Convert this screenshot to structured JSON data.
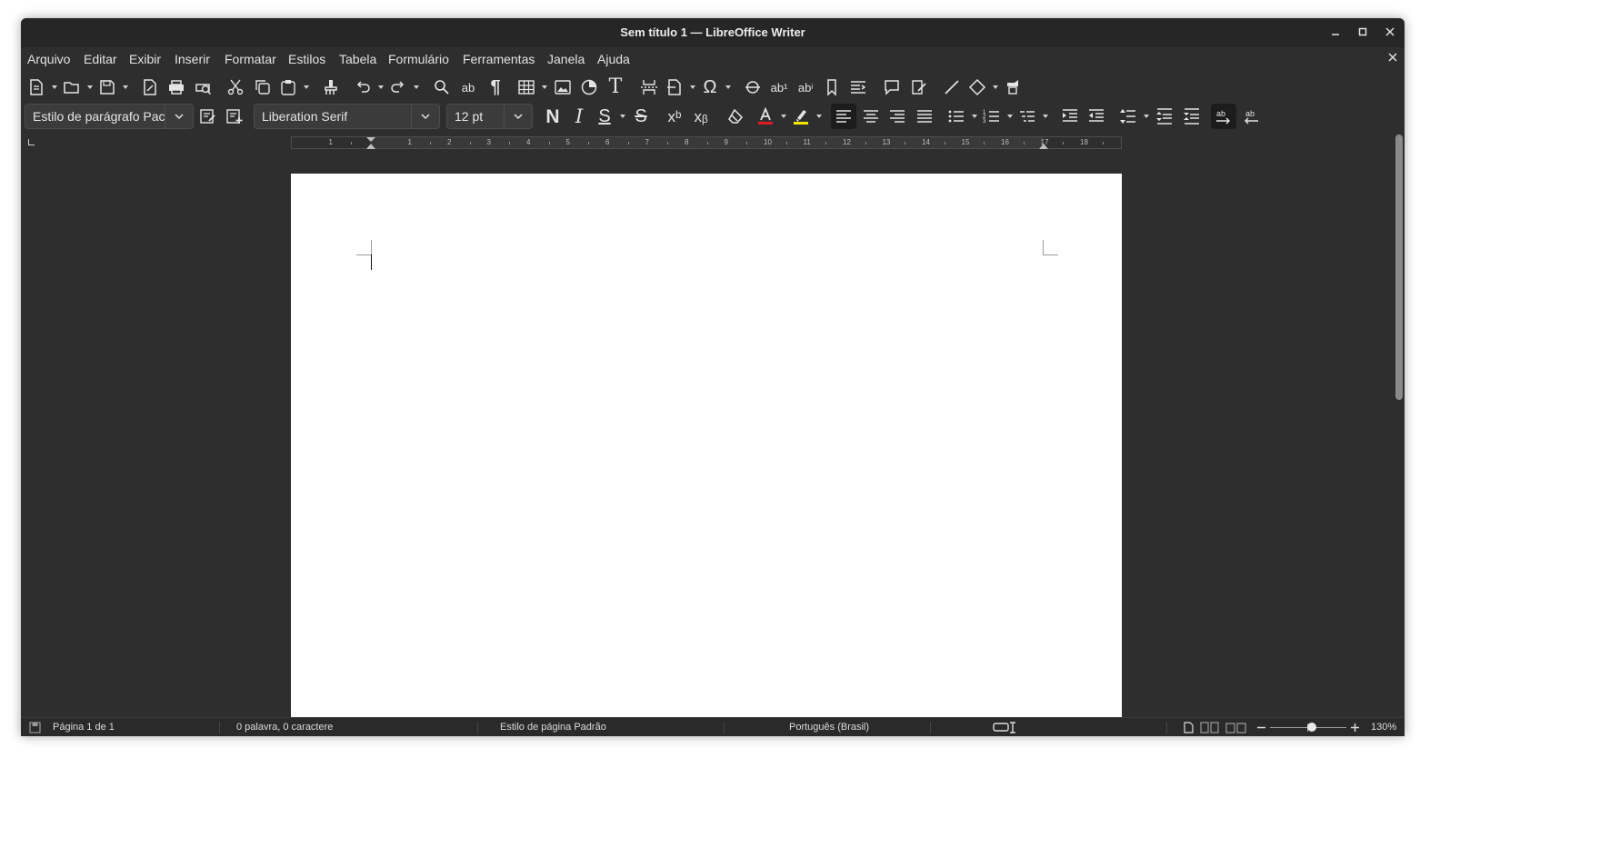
{
  "window": {
    "title": "Sem título 1 — LibreOffice Writer"
  },
  "menu": [
    "Arquivo",
    "Editar",
    "Exibir",
    "Inserir",
    "Formatar",
    "Estilos",
    "Tabela",
    "Formulário",
    "Ferramentas",
    "Janela",
    "Ajuda"
  ],
  "formatting": {
    "paragraph_style": "Estilo de parágrafo Pac",
    "font_name": "Liberation Serif",
    "font_size": "12 pt",
    "bold_label": "N",
    "italic_label": "I",
    "underline_label": "S",
    "strike_label": "S",
    "superscript_label": "xᵇ",
    "subscript_label": "xᵦ"
  },
  "ruler": {
    "numbers": [
      "1",
      "1",
      "2",
      "3",
      "4",
      "5",
      "6",
      "7",
      "8",
      "9",
      "10",
      "11",
      "12",
      "13",
      "14",
      "15",
      "16",
      "17",
      "18"
    ]
  },
  "statusbar": {
    "page": "Página 1 de 1",
    "words": "0 palavra, 0 caractere",
    "page_style": "Estilo de página Padrão",
    "language": "Português (Brasil)",
    "zoom": "130%",
    "zoom_level": 0.55
  },
  "colors": {
    "font_color": "#e01b24",
    "highlight": "#f5e600",
    "page": "#ffffff",
    "background": "#2e2e2e"
  },
  "icons": {
    "new": "new-document-icon",
    "open": "open-icon",
    "save": "save-icon",
    "export_pdf": "export-pdf-icon",
    "print": "print-icon",
    "preview": "print-preview-icon",
    "cut": "cut-icon",
    "copy": "copy-icon",
    "paste": "paste-icon",
    "clone": "clone-formatting-icon",
    "undo": "undo-icon",
    "redo": "redo-icon",
    "find": "find-replace-icon",
    "spelling": "spelling-icon",
    "pilcrow": "formatting-marks-icon",
    "table": "table-icon",
    "image": "image-icon",
    "chart": "chart-icon",
    "textbox": "text-box-icon",
    "page_break": "page-break-icon",
    "field": "field-icon",
    "special_char": "special-character-icon",
    "hyperlink": "hyperlink-icon",
    "footnote": "footnote-icon",
    "endnote": "endnote-icon",
    "bookmark": "bookmark-icon",
    "cross_ref": "cross-reference-icon",
    "comment": "comment-icon",
    "track_changes": "track-changes-icon",
    "line": "line-icon",
    "shapes": "basic-shapes-icon",
    "draw": "draw-functions-icon"
  }
}
